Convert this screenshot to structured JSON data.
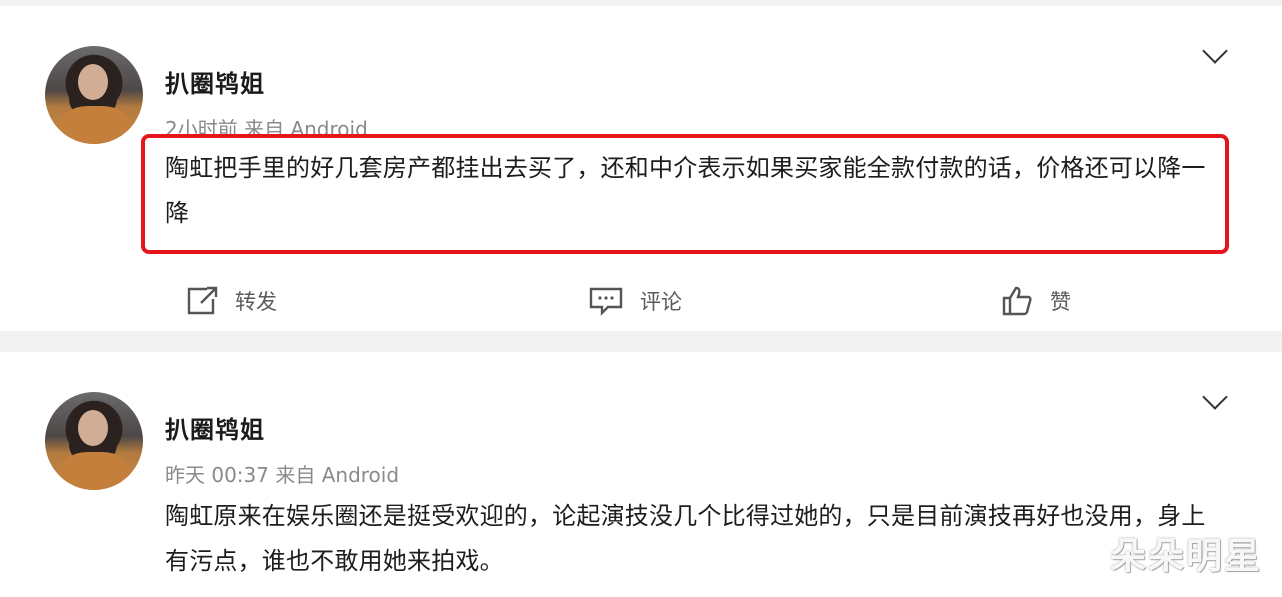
{
  "posts": [
    {
      "username": "扒圈鸨姐",
      "meta": "2小时前  来自 Android",
      "text": "陶虹把手里的好几套房产都挂出去买了，还和中介表示如果买家能全款付款的话，价格还可以降一降",
      "highlight_color": "#e4151b",
      "actions": {
        "repost": "转发",
        "comment": "评论",
        "like": "赞"
      }
    },
    {
      "username": "扒圈鸨姐",
      "meta": "昨天 00:37  来自 Android",
      "text": "陶虹原来在娱乐圈还是挺受欢迎的，论起演技没几个比得过她的，只是目前演技再好也没用，身上有污点，谁也不敢用她来拍戏。"
    }
  ],
  "watermark": "朵朵明星",
  "icons": {
    "avatar": "avatar",
    "menu": "chevron-down-icon",
    "repost": "share-icon",
    "comment": "comment-icon",
    "like": "thumbs-up-icon"
  }
}
